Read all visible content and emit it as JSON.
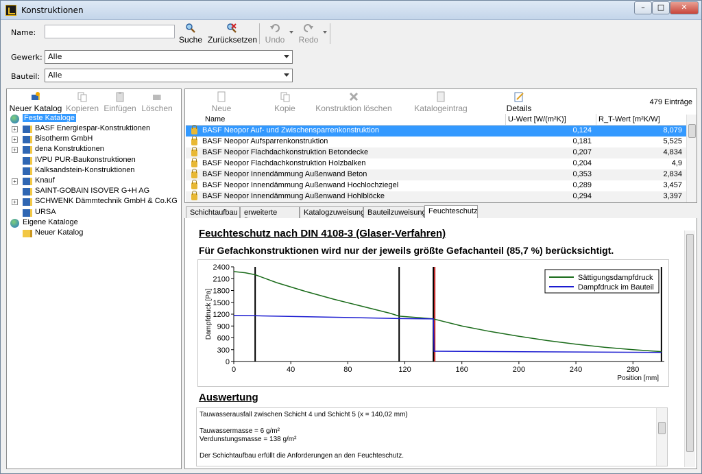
{
  "window": {
    "title": "Konstruktionen"
  },
  "search": {
    "name_label": "Name:",
    "name_value": "",
    "buttons": {
      "suche": "Suche",
      "zuruecksetzen": "Zurücksetzen",
      "undo": "Undo",
      "redo": "Redo"
    },
    "gewerk_label": "Gewerk:",
    "gewerk_value": "Alle",
    "bauteil_label": "Bauteil:",
    "bauteil_value": "Alle"
  },
  "left_toolbar": {
    "neuer_katalog": "Neuer Katalog",
    "kopieren": "Kopieren",
    "einfuegen": "Einfügen",
    "loeschen": "Löschen"
  },
  "tree": {
    "root1": "Feste Kataloge",
    "items": [
      "BASF Energiespar-Konstruktionen",
      "Bisotherm GmbH",
      "dena Konstruktionen",
      "IVPU PUR-Baukonstruktionen",
      "Kalksandstein-Konstruktionen",
      "Knauf",
      "SAINT-GOBAIN ISOVER G+H AG",
      "SCHWENK Dämmtechnik GmbH & Co.KG",
      "URSA"
    ],
    "root2": "Eigene Kataloge",
    "child2": "Neuer Katalog"
  },
  "right_toolbar": {
    "neue_konstruktion": "Neue Konstruktion",
    "kopie_anlegen": "Kopie anlegen",
    "konstruktion_loeschen": "Konstruktion löschen",
    "katalogeintrag_entfernen": "Katalogeintrag entfernen",
    "details_anzeigen": "Details anzeigen",
    "count": "479 Einträge"
  },
  "grid": {
    "headers": {
      "name": "Name",
      "u": "U-Wert [W/(m²K)]",
      "rt": "R_T-Wert [m²K/W]"
    },
    "rows": [
      {
        "name": "BASF Neopor Auf- und Zwischensparrenkonstruktion",
        "u": "0,124",
        "rt": "8,079"
      },
      {
        "name": "BASF Neopor Aufsparrenkonstruktion",
        "u": "0,181",
        "rt": "5,525"
      },
      {
        "name": "BASF Neopor Flachdachkonstruktion Betondecke",
        "u": "0,207",
        "rt": "4,834"
      },
      {
        "name": "BASF Neopor Flachdachkonstruktion Holzbalken",
        "u": "0,204",
        "rt": "4,9"
      },
      {
        "name": "BASF Neopor Innendämmung Außenwand Beton",
        "u": "0,353",
        "rt": "2,834"
      },
      {
        "name": "BASF Neopor Innendämmung Außenwand Hochlochziegel",
        "u": "0,289",
        "rt": "3,457"
      },
      {
        "name": "BASF Neopor Innendämmung Außenwand Hohlblöcke",
        "u": "0,294",
        "rt": "3,397"
      }
    ]
  },
  "tabs": [
    "Schichtaufbau",
    "erweiterte Daten",
    "Katalogzuweisung",
    "Bauteilzuweisung",
    "Feuchteschutz"
  ],
  "feuchte": {
    "heading": "Feuchteschutz nach DIN 4108-3 (Glaser-Verfahren)",
    "subheading": "Für Gefachkonstruktionen wird nur der jeweils größte Gefachanteil (85,7 %) berücksichtigt.",
    "auswertung_heading": "Auswertung",
    "auswertung_lines": [
      "Tauwasserausfall zwischen Schicht 4 und Schicht 5 (x = 140,02 mm)",
      "Tauwassermasse = 6 g/m²",
      "Verdunstungsmasse = 138 g/m²",
      "Der Schichtaufbau erfüllt die Anforderungen an den Feuchteschutz."
    ]
  },
  "chart_data": {
    "type": "line",
    "ylabel": "Dampfdruck [Pa]",
    "xlabel": "Position [mm]",
    "xlim": [
      0,
      302
    ],
    "ylim": [
      0,
      2400
    ],
    "xticks": [
      0,
      40,
      80,
      120,
      160,
      200,
      240,
      280
    ],
    "yticks": [
      0,
      300,
      600,
      900,
      1200,
      1500,
      1800,
      2100,
      2400
    ],
    "layer_boundaries": [
      15,
      116,
      140,
      300
    ],
    "condensation_x": 140,
    "legend_position": "top-right",
    "colors": {
      "saturation": "#1a6b1a",
      "vapor": "#1b1bd0",
      "condensation": "#c02020"
    },
    "series": [
      {
        "name": "Sättigungsdampfdruck",
        "x": [
          0,
          8,
          15,
          30,
          50,
          70,
          90,
          110,
          116,
          130,
          140,
          160,
          180,
          200,
          220,
          240,
          260,
          280,
          300
        ],
        "y": [
          2280,
          2250,
          2200,
          2000,
          1780,
          1580,
          1400,
          1220,
          1150,
          1110,
          1080,
          900,
          760,
          640,
          530,
          440,
          360,
          300,
          250
        ]
      },
      {
        "name": "Dampfdruck im Bauteil",
        "x": [
          0,
          15,
          116,
          140,
          140.5,
          300
        ],
        "y": [
          1170,
          1160,
          1090,
          1080,
          260,
          230
        ]
      }
    ]
  }
}
